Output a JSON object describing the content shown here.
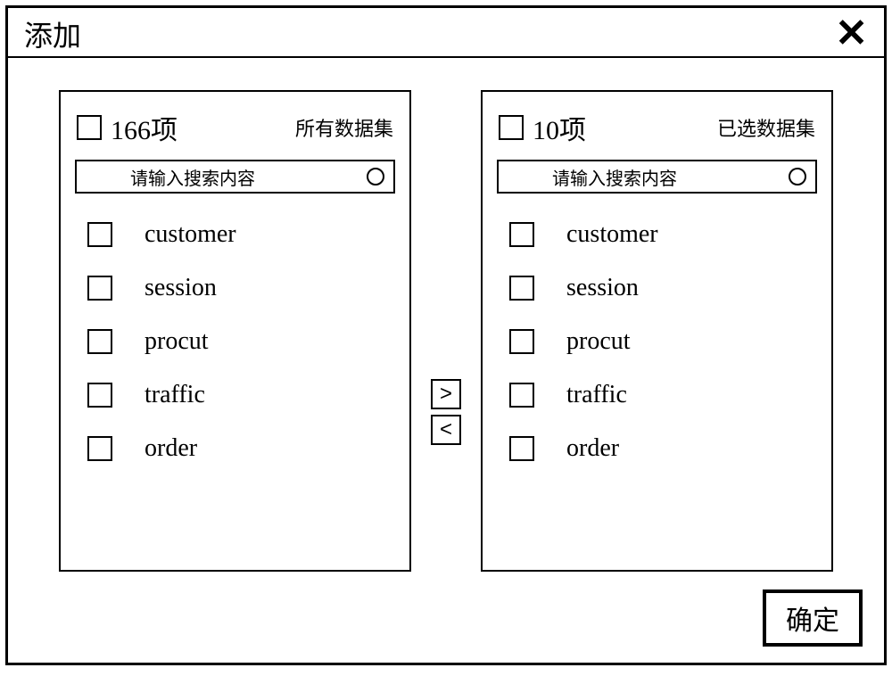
{
  "header": {
    "title": "添加",
    "close_glyph": "✕"
  },
  "left": {
    "count_label": "166项",
    "subtitle": "所有数据集",
    "search_placeholder": "请输入搜索内容",
    "items": [
      "customer",
      "session",
      "procut",
      "traffic",
      "order"
    ]
  },
  "right": {
    "count_label": "10项",
    "subtitle": "已选数据集",
    "search_placeholder": "请输入搜索内容",
    "items": [
      "customer",
      "session",
      "procut",
      "traffic",
      "order"
    ]
  },
  "controls": {
    "move_right": ">",
    "move_left": "<"
  },
  "footer": {
    "confirm_label": "确定"
  }
}
